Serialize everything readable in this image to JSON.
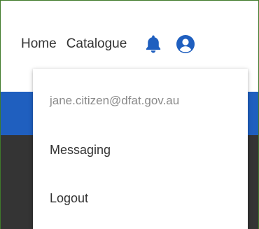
{
  "nav": {
    "home_label": "Home",
    "catalogue_label": "Catalogue"
  },
  "icons": {
    "notifications": "bell-icon",
    "account": "user-circle-icon",
    "accent_color": "#1f5fbf"
  },
  "bands": {
    "blue": "#1f5fbf",
    "dark": "#343434"
  },
  "account_menu": {
    "email": "jane.citizen@dfat.gov.au",
    "items": [
      {
        "label": "Messaging"
      },
      {
        "label": "Logout"
      }
    ]
  }
}
